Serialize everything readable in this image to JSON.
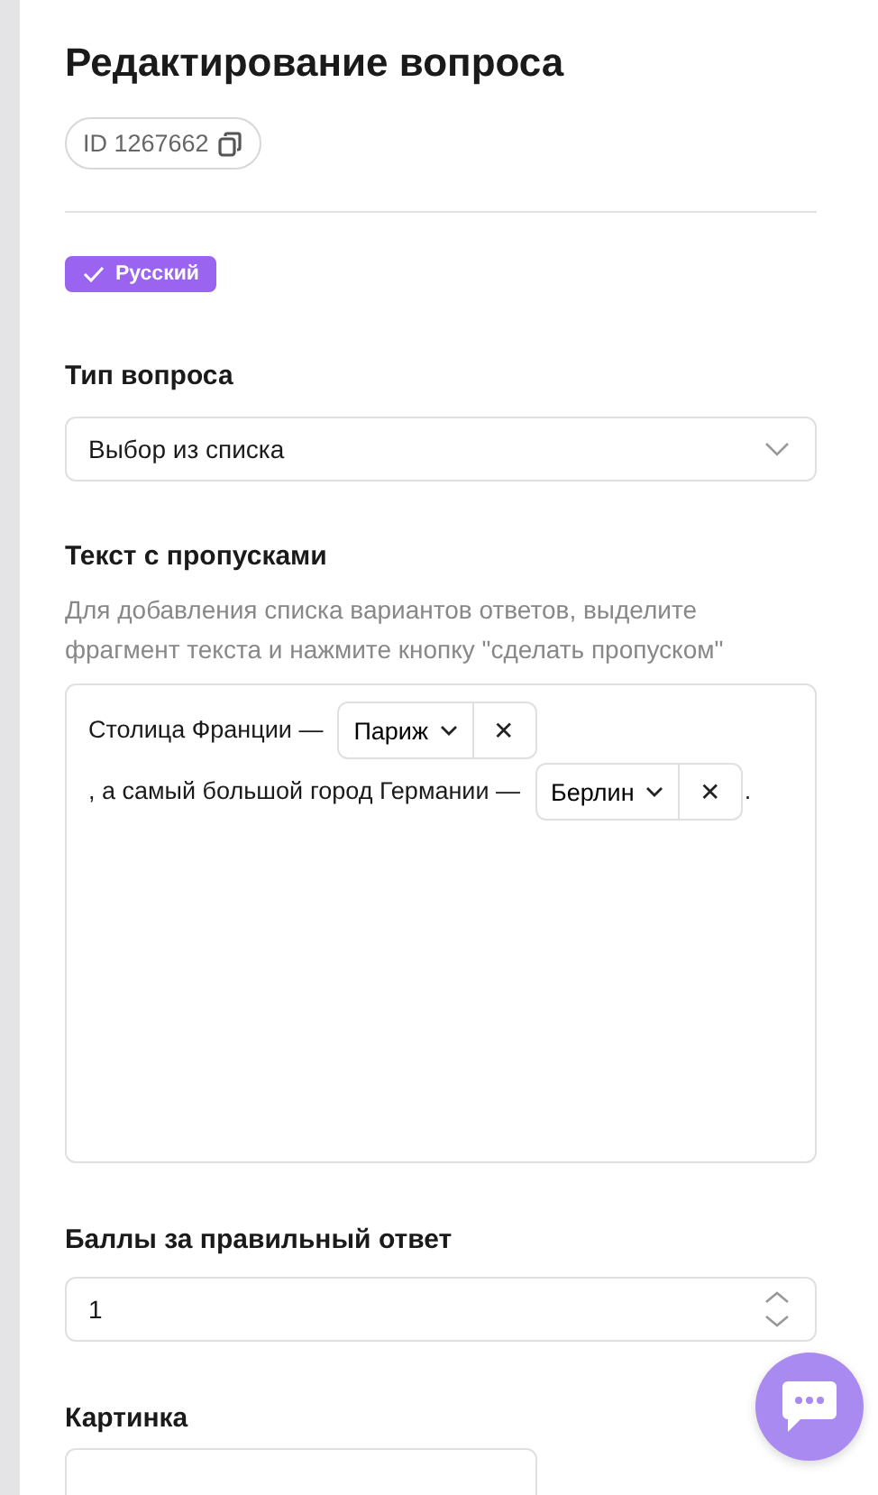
{
  "title": "Редактирование вопроса",
  "id_chip": {
    "label": "ID 1267662"
  },
  "languages": [
    {
      "label": "Русский",
      "selected": true
    }
  ],
  "question_type": {
    "label": "Тип вопроса",
    "value": "Выбор из списка"
  },
  "gap_text": {
    "label": "Текст с пропусками",
    "hint": "Для добавления списка вариантов ответов, выделите фрагмент текста и нажмите кнопку \"сделать пропуском\"",
    "segments": [
      {
        "kind": "text",
        "text": "Столица Франции —"
      },
      {
        "kind": "blank",
        "value": "Париж",
        "remove": "✕"
      },
      {
        "kind": "text",
        "text": ", а самый большой"
      },
      {
        "kind": "text",
        "text": "город Германии —"
      },
      {
        "kind": "blank",
        "value": "Берлин",
        "remove": "✕"
      },
      {
        "kind": "text",
        "text": "."
      }
    ]
  },
  "points": {
    "label": "Баллы за правильный ответ",
    "value": "1"
  },
  "image": {
    "label": "Картинка"
  }
}
